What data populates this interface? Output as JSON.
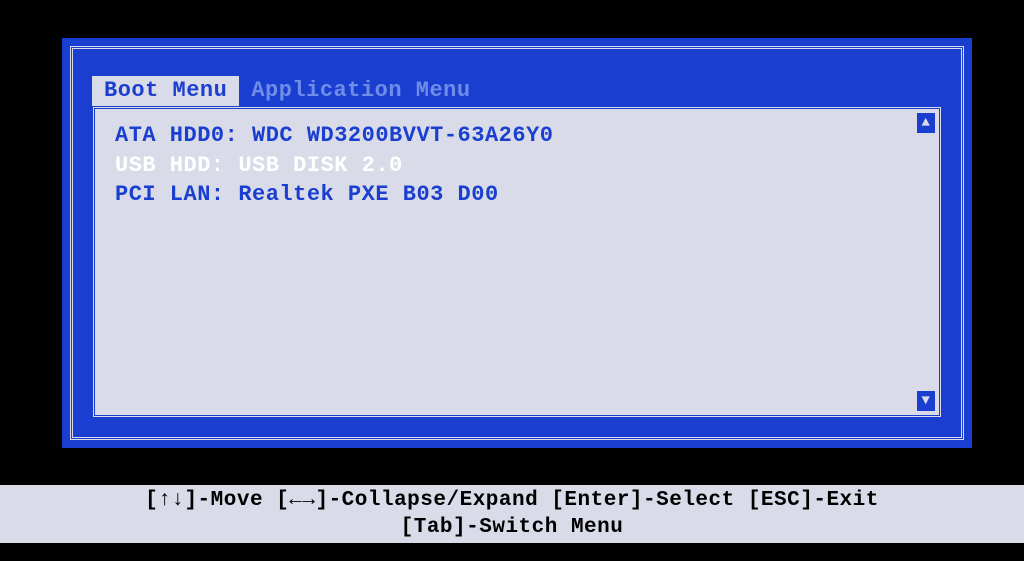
{
  "tabs": {
    "active": "Boot Menu",
    "inactive": "Application Menu"
  },
  "boot_items": [
    {
      "label": "ATA HDD0",
      "value": "WDC WD3200BVVT-63A26Y0",
      "selected": false
    },
    {
      "label": "USB HDD",
      "value": "USB DISK 2.0",
      "selected": true
    },
    {
      "label": "PCI LAN",
      "value": "Realtek PXE B03 D00",
      "selected": false
    }
  ],
  "footer": {
    "line1": "[↑↓]-Move [←→]-Collapse/Expand [Enter]-Select [ESC]-Exit",
    "line2": "[Tab]-Switch Menu"
  },
  "scroll_up": "▲",
  "scroll_down": "▼"
}
